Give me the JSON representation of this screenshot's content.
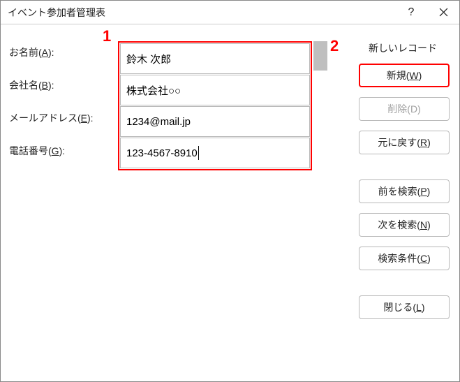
{
  "title": "イベント参加者管理表",
  "annotations": {
    "one": "1",
    "two": "2"
  },
  "fields": {
    "name": {
      "label_pre": "お名前(",
      "accel": "A",
      "label_post": "):",
      "value": "鈴木 次郎"
    },
    "company": {
      "label_pre": "会社名(",
      "accel": "B",
      "label_post": "):",
      "value": "株式会社○○"
    },
    "email": {
      "label_pre": "メールアドレス(",
      "accel": "E",
      "label_post": "):",
      "value": "1234@mail.jp"
    },
    "phone": {
      "label_pre": "電話番号(",
      "accel": "G",
      "label_post": "):",
      "value": "123-4567-8910"
    }
  },
  "record_label": "新しいレコード",
  "buttons": {
    "new": {
      "pre": "新規(",
      "accel": "W",
      "post": ")"
    },
    "delete": {
      "pre": "削除(",
      "accel": "D",
      "post": ")"
    },
    "restore": {
      "pre": "元に戻す(",
      "accel": "R",
      "post": ")"
    },
    "prev": {
      "pre": "前を検索(",
      "accel": "P",
      "post": ")"
    },
    "next": {
      "pre": "次を検索(",
      "accel": "N",
      "post": ")"
    },
    "criteria": {
      "pre": "検索条件(",
      "accel": "C",
      "post": ")"
    },
    "close": {
      "pre": "閉じる(",
      "accel": "L",
      "post": ")"
    }
  }
}
